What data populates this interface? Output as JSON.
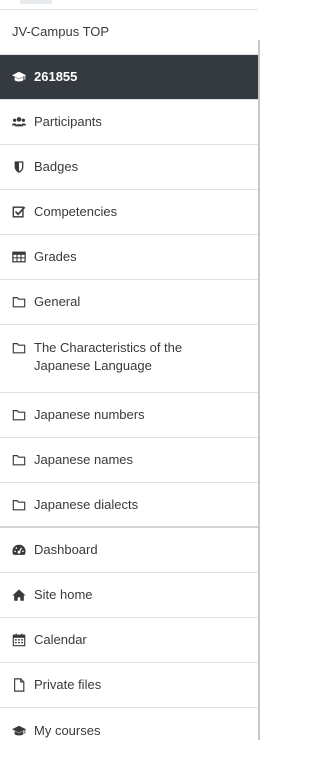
{
  "nav": {
    "site_link": "JV-Campus TOP",
    "course_id": "261855",
    "course_items": [
      {
        "label": "Participants",
        "icon": "users-icon"
      },
      {
        "label": "Badges",
        "icon": "shield-icon"
      },
      {
        "label": "Competencies",
        "icon": "checkbox-icon"
      },
      {
        "label": "Grades",
        "icon": "table-icon"
      }
    ],
    "sections": [
      {
        "label": "General",
        "icon": "folder-icon"
      },
      {
        "label": "The Characteristics of the Japanese Language",
        "icon": "folder-icon"
      },
      {
        "label": "Japanese numbers",
        "icon": "folder-icon"
      },
      {
        "label": "Japanese names",
        "icon": "folder-icon"
      },
      {
        "label": "Japanese dialects",
        "icon": "folder-icon"
      }
    ],
    "site_items": [
      {
        "label": "Dashboard",
        "icon": "dashboard-icon"
      },
      {
        "label": "Site home",
        "icon": "home-icon"
      },
      {
        "label": "Calendar",
        "icon": "calendar-icon"
      },
      {
        "label": "Private files",
        "icon": "file-icon"
      },
      {
        "label": "My courses",
        "icon": "graduation-cap-icon"
      }
    ]
  },
  "colors": {
    "active_bg": "#343a40",
    "text": "#373a3c",
    "border": "#dee2e6"
  }
}
